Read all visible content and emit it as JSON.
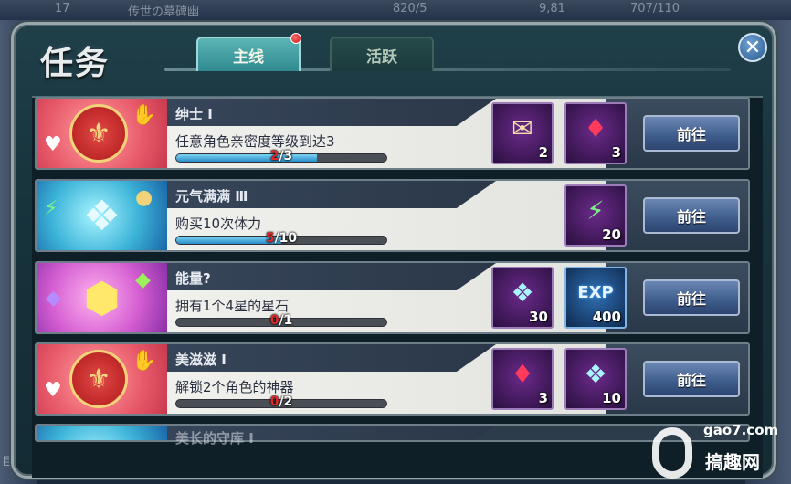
{
  "background": {
    "top_texts": [
      "17",
      "传世の墓碑幽",
      "820/5",
      "9,81",
      "707/110"
    ],
    "bottom_left_text": "巨鸡?"
  },
  "window": {
    "title": "任务",
    "tabs": [
      {
        "label": "主线",
        "active": true,
        "has_notification": true
      },
      {
        "label": "活跃",
        "active": false,
        "has_notification": false
      }
    ],
    "close_icon": "close-icon"
  },
  "quests": [
    {
      "name": "绅士 Ⅰ",
      "description": "任意角色亲密度等级到达3",
      "progress": {
        "current": "2",
        "total": "/3",
        "fraction": 0.67
      },
      "icon": "fleur-emblem-icon",
      "rewards": [
        {
          "icon": "letter-icon",
          "count": "2"
        },
        {
          "icon": "ruby-icon",
          "count": "3"
        }
      ],
      "button": "前往"
    },
    {
      "name": "元气满满 Ⅲ",
      "description": "购买10次体力",
      "progress": {
        "current": "5",
        "total": "/10",
        "fraction": 0.5
      },
      "icon": "crystal-energy-icon",
      "rewards": [
        {
          "icon": "lightning-icon",
          "count": "20"
        }
      ],
      "button": "前往"
    },
    {
      "name": "能量?",
      "description": "拥有1个4星的星石",
      "progress": {
        "current": "0",
        "total": "/1",
        "fraction": 0
      },
      "icon": "rainbow-gem-icon",
      "rewards": [
        {
          "icon": "crystal-icon",
          "count": "30"
        },
        {
          "icon": "exp-icon",
          "count": "400",
          "label": "EXP"
        }
      ],
      "button": "前往"
    },
    {
      "name": "美滋滋 Ⅰ",
      "description": "解锁2个角色的神器",
      "progress": {
        "current": "0",
        "total": "/2",
        "fraction": 0
      },
      "icon": "fleur-emblem-icon",
      "rewards": [
        {
          "icon": "ruby-icon",
          "count": "3"
        },
        {
          "icon": "crystal-icon",
          "count": "10"
        }
      ],
      "button": "前往"
    }
  ],
  "partial_quest": {
    "name": "美长的守库 Ⅰ"
  },
  "watermark": {
    "site": "gao7.com",
    "name": "搞趣网"
  }
}
